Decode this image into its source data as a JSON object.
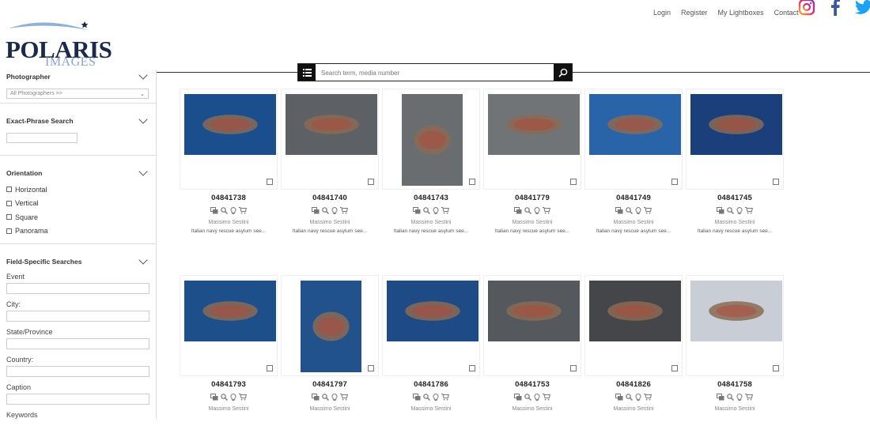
{
  "nav": {
    "links": [
      "Login",
      "Register",
      "My Lightboxes",
      "Contact"
    ],
    "social": [
      "instagram-icon",
      "facebook-icon",
      "twitter-icon"
    ]
  },
  "logo": {
    "text": "POLARIS",
    "sub": "IMAGES"
  },
  "search": {
    "placeholder": "Search term, media number"
  },
  "sidebar": {
    "photographer": {
      "title": "Photographer",
      "select": "All Photographers >>"
    },
    "exact": {
      "title": "Exact-Phrase Search"
    },
    "orientation": {
      "title": "Orientation",
      "options": [
        "Horizontal",
        "Vertical",
        "Square",
        "Panorama"
      ]
    },
    "field": {
      "title": "Field-Specific Searches",
      "fields": [
        "Event",
        "City:",
        "State/Province",
        "Country:",
        "Caption",
        "Keywords"
      ]
    }
  },
  "results": [
    {
      "number": "04841738",
      "photographer": "Massimo Sestini",
      "caption": "Italian navy rescue asylum see..."
    },
    {
      "number": "04841740",
      "photographer": "Massimo Sestini",
      "caption": "Italian navy rescue asylum see..."
    },
    {
      "number": "04841743",
      "photographer": "Massimo Sestini",
      "caption": "Italian navy rescue asylum see..."
    },
    {
      "number": "04841779",
      "photographer": "Massimo Sestini",
      "caption": "Italian navy rescue asylum see..."
    },
    {
      "number": "04841749",
      "photographer": "Massimo Sestini",
      "caption": "Italian navy rescue asylum see..."
    },
    {
      "number": "04841745",
      "photographer": "Massimo Sestini",
      "caption": "Italian navy rescue asylum see..."
    },
    {
      "number": "04841793",
      "photographer": "Massimo Sestini",
      "caption": ""
    },
    {
      "number": "04841797",
      "photographer": "Massimo Sestini",
      "caption": ""
    },
    {
      "number": "04841786",
      "photographer": "Massimo Sestini",
      "caption": ""
    },
    {
      "number": "04841753",
      "photographer": "Massimo Sestini",
      "caption": ""
    },
    {
      "number": "04841826",
      "photographer": "Massimo Sestini",
      "caption": ""
    },
    {
      "number": "04841758",
      "photographer": "Massimo Sestini",
      "caption": ""
    }
  ],
  "colors": {
    "accent": "#111111",
    "sea_blue": "#1d4f8a",
    "sea_grey": "#5e6166",
    "logo": "#1b2a4a"
  }
}
